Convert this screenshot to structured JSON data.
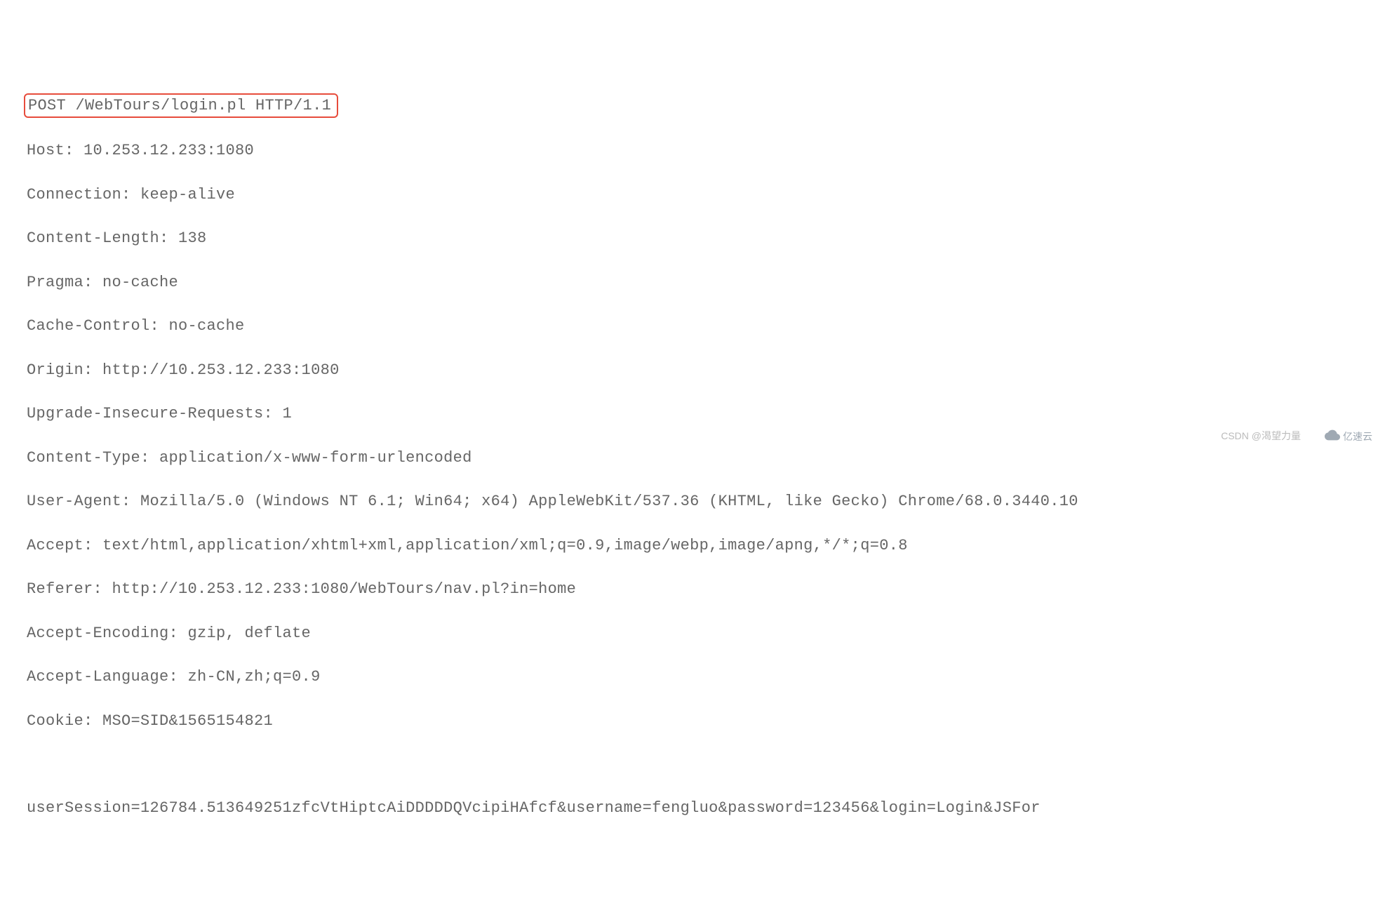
{
  "request_line": "POST /WebTours/login.pl HTTP/1.1",
  "headers": [
    "Host: 10.253.12.233:1080",
    "Connection: keep-alive",
    "Content-Length: 138",
    "Pragma: no-cache",
    "Cache-Control: no-cache",
    "Origin: http://10.253.12.233:1080",
    "Upgrade-Insecure-Requests: 1",
    "Content-Type: application/x-www-form-urlencoded",
    "User-Agent: Mozilla/5.0 (Windows NT 6.1; Win64; x64) AppleWebKit/537.36 (KHTML, like Gecko) Chrome/68.0.3440.10",
    "Accept: text/html,application/xhtml+xml,application/xml;q=0.9,image/webp,image/apng,*/*;q=0.8",
    "Referer: http://10.253.12.233:1080/WebTours/nav.pl?in=home",
    "Accept-Encoding: gzip, deflate",
    "Accept-Language: zh-CN,zh;q=0.9",
    "Cookie: MSO=SID&1565154821"
  ],
  "body": "userSession=126784.513649251zfcVtHiptcAiDDDDDQVcipiHAfcf&username=fengluo&password=123456&login=Login&JSFor",
  "watermark_left": "CSDN @渴望力量",
  "watermark_right": "亿速云"
}
